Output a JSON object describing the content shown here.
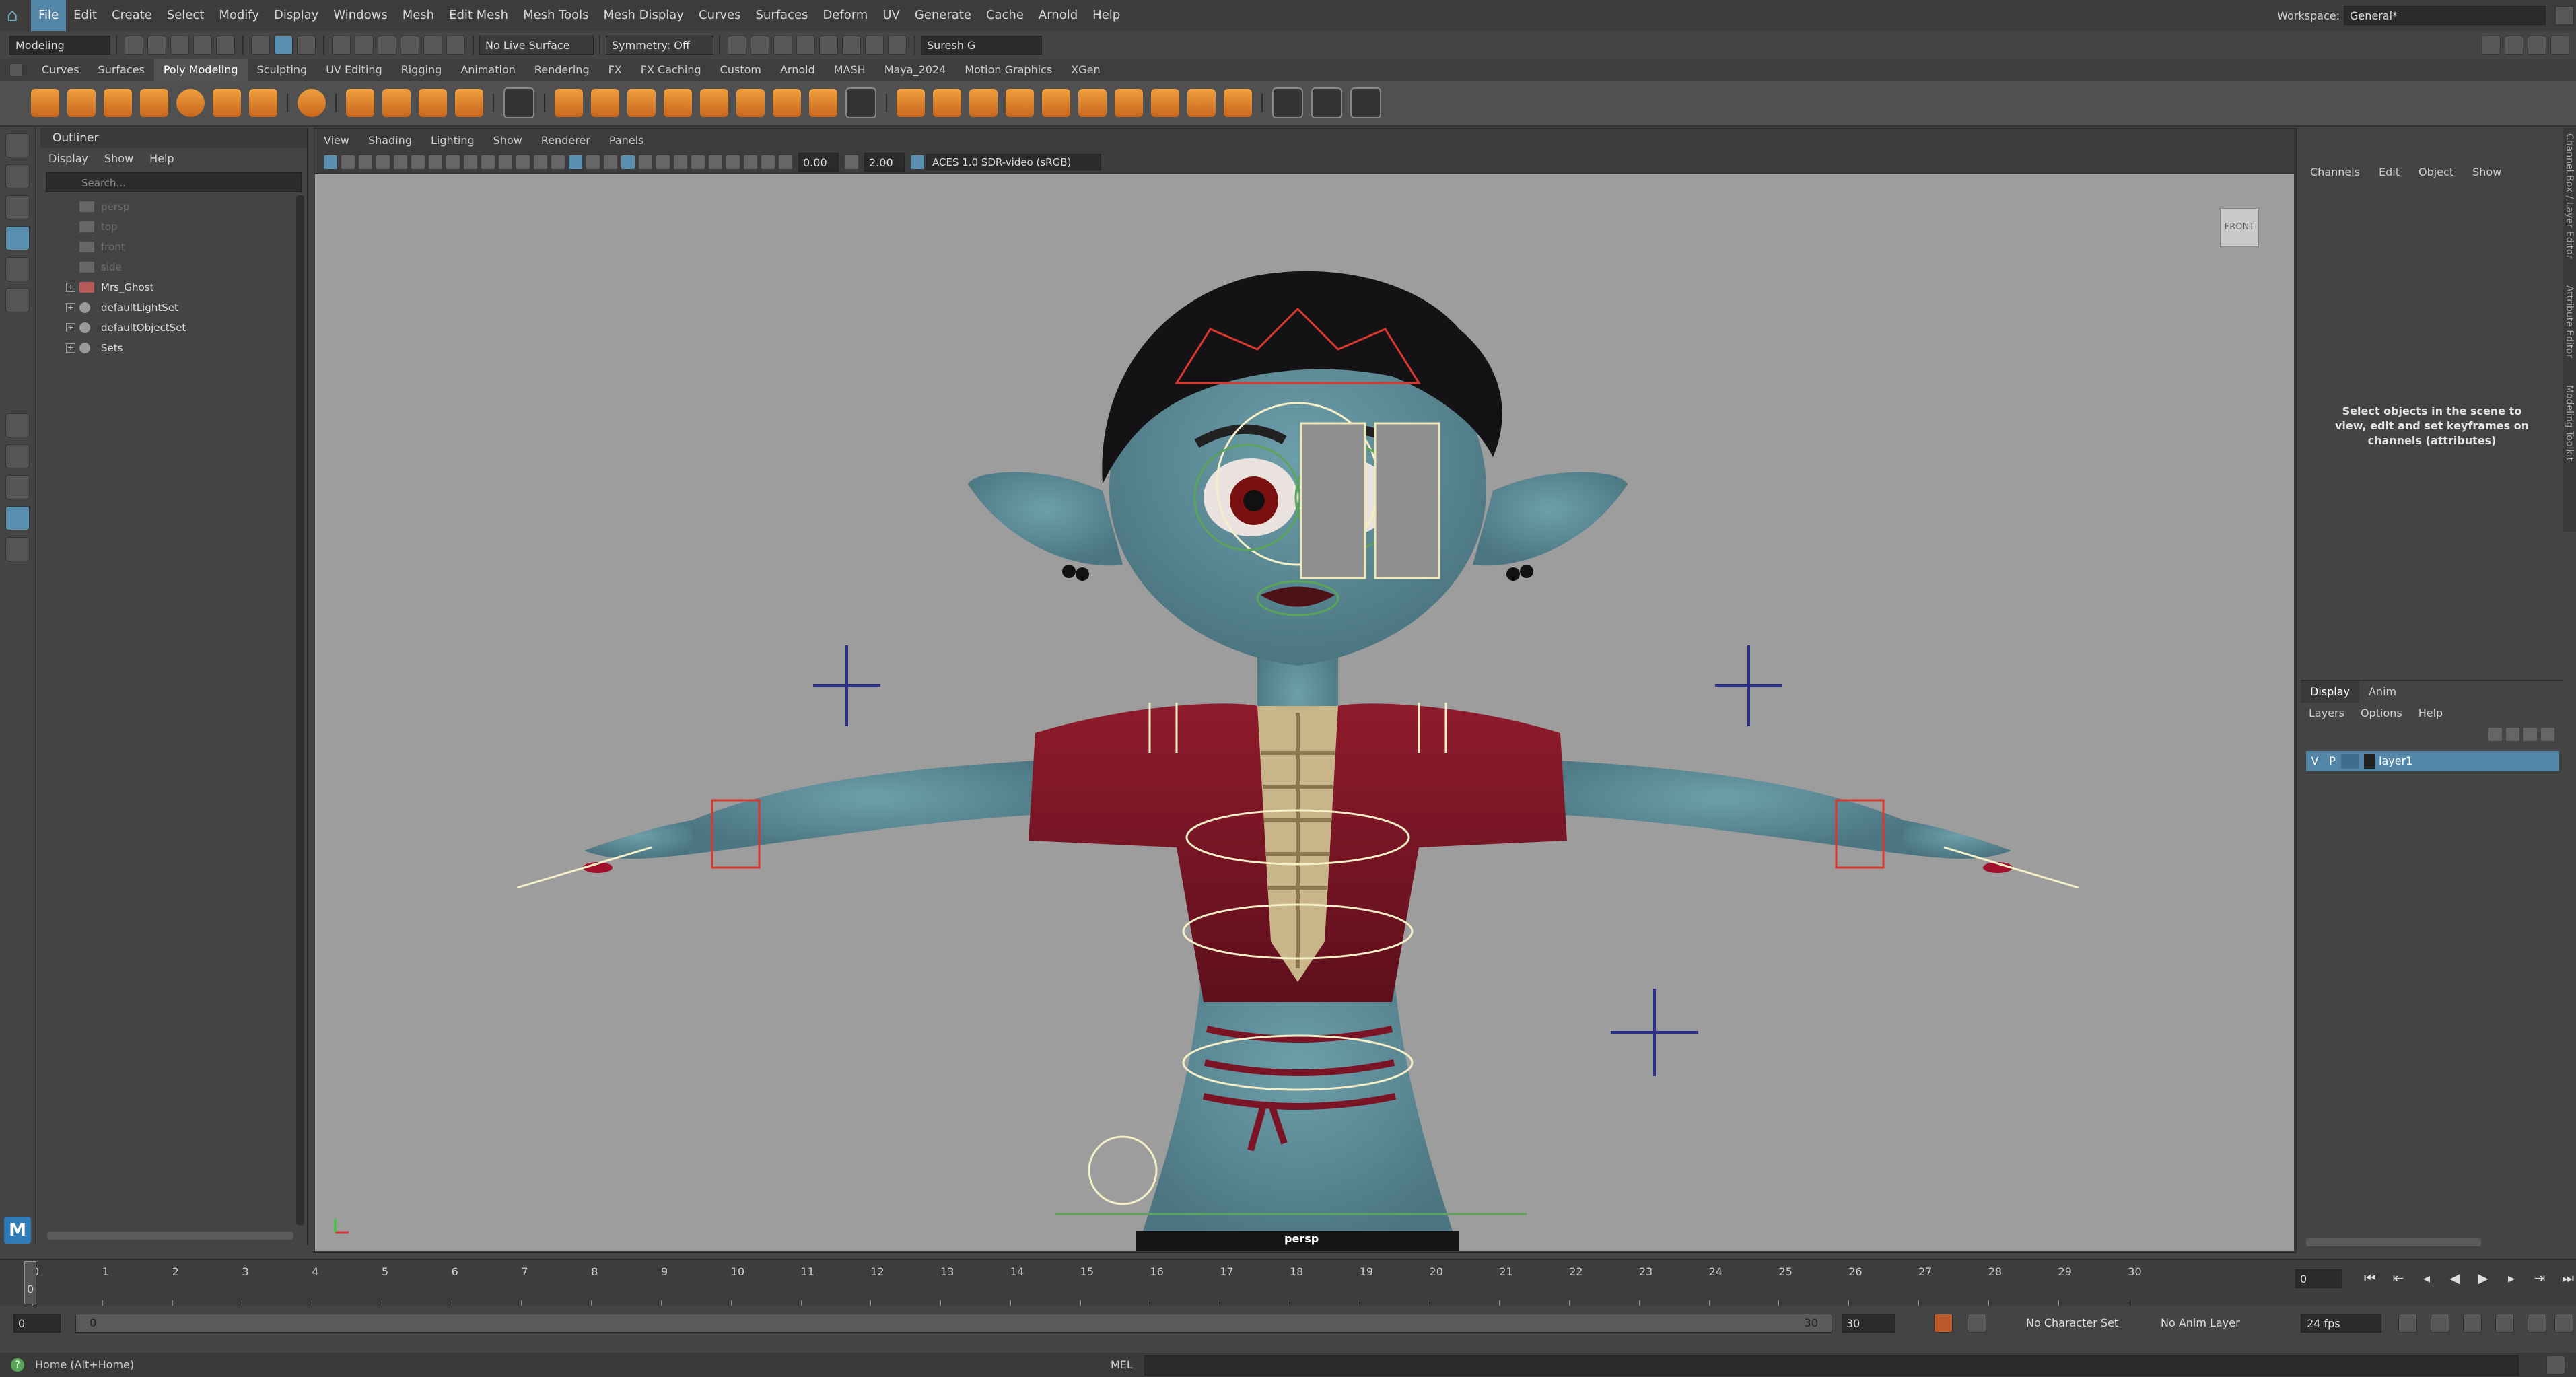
{
  "app": {
    "name": "Maya"
  },
  "menubar": {
    "items": [
      "File",
      "Edit",
      "Create",
      "Select",
      "Modify",
      "Display",
      "Windows",
      "Mesh",
      "Edit Mesh",
      "Mesh Tools",
      "Mesh Display",
      "Curves",
      "Surfaces",
      "Deform",
      "UV",
      "Generate",
      "Cache",
      "Arnold",
      "Help"
    ],
    "workspace_label": "Workspace:",
    "workspace_value": "General*"
  },
  "statusline": {
    "mode": "Modeling",
    "live_surface": "No Live Surface",
    "symmetry": "Symmetry: Off",
    "user": "Suresh G"
  },
  "shelf": {
    "tabs": [
      "Curves",
      "Surfaces",
      "Poly Modeling",
      "Sculpting",
      "UV Editing",
      "Rigging",
      "Animation",
      "Rendering",
      "FX",
      "FX Caching",
      "Custom",
      "Arnold",
      "MASH",
      "Maya_2024",
      "Motion Graphics",
      "XGen"
    ],
    "active_tab": "Poly Modeling"
  },
  "outliner": {
    "title": "Outliner",
    "menu": [
      "Display",
      "Show",
      "Help"
    ],
    "search_placeholder": "Search...",
    "items": [
      {
        "label": "persp",
        "type": "camera",
        "dim": true
      },
      {
        "label": "top",
        "type": "camera",
        "dim": true
      },
      {
        "label": "front",
        "type": "camera",
        "dim": true
      },
      {
        "label": "side",
        "type": "camera",
        "dim": true
      },
      {
        "label": "Mrs_Ghost",
        "type": "group",
        "dim": false
      },
      {
        "label": "defaultLightSet",
        "type": "set",
        "dim": false
      },
      {
        "label": "defaultObjectSet",
        "type": "set",
        "dim": false
      },
      {
        "label": "Sets",
        "type": "set",
        "dim": false
      }
    ]
  },
  "viewport": {
    "menu": [
      "View",
      "Shading",
      "Lighting",
      "Show",
      "Renderer",
      "Panels"
    ],
    "exposure": "0.00",
    "gamma": "2.00",
    "color_space": "ACES 1.0 SDR-video (sRGB)",
    "camera_label": "persp",
    "viewcube_label": "FRONT"
  },
  "channelbox": {
    "menu": [
      "Channels",
      "Edit",
      "Object",
      "Show"
    ],
    "message": "Select objects in the scene to view, edit and set keyframes on channels (attributes)"
  },
  "layereditor": {
    "tabs": [
      "Display",
      "Anim"
    ],
    "menu": [
      "Layers",
      "Options",
      "Help"
    ],
    "layer_name": "layer1",
    "visibility": "V",
    "playback": "P"
  },
  "sidetabs": [
    "Channel Box / Layer Editor",
    "Attribute Editor",
    "Modeling Toolkit"
  ],
  "timeline": {
    "ticks": [
      "0",
      "1",
      "2",
      "3",
      "4",
      "5",
      "6",
      "7",
      "8",
      "9",
      "10",
      "11",
      "12",
      "13",
      "14",
      "15",
      "16",
      "17",
      "18",
      "19",
      "20",
      "21",
      "22",
      "23",
      "24",
      "25",
      "26",
      "27",
      "28",
      "29",
      "30"
    ],
    "current_frame": "0",
    "current_frame_field": "0"
  },
  "rangebar": {
    "start": "0",
    "inner_start": "0",
    "inner_end": "30",
    "end": "30",
    "character_set": "No Character Set",
    "anim_layer": "No Anim Layer",
    "fps": "24 fps"
  },
  "helpline": {
    "text": "Home (Alt+Home)",
    "mel_label": "MEL"
  }
}
